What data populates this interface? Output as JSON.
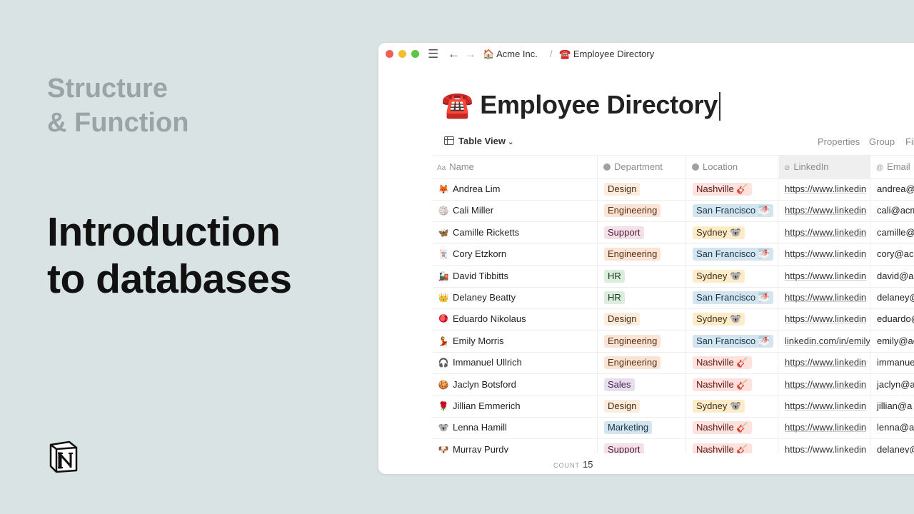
{
  "slide": {
    "subtitle": "Structure\n& Function",
    "title": "Introduction\nto databases"
  },
  "colors": {
    "background": "#d9e3e4",
    "subtitle": "#9aa3a6",
    "title": "#111111"
  },
  "window": {
    "breadcrumb": [
      {
        "icon": "🏠",
        "label": "Acme Inc."
      },
      {
        "icon": "☎️",
        "label": "Employee Directory"
      }
    ],
    "breadcrumb_separator": "/",
    "page_icon": "☎️",
    "page_title": "Employee Directory",
    "view_label": "Table View",
    "toolbar": {
      "properties": "Properties",
      "group": "Group",
      "filter": "Fil"
    },
    "columns": {
      "name": "Name",
      "department": "Department",
      "location": "Location",
      "linkedin": "LinkedIn",
      "email": "Email"
    },
    "rows": [
      {
        "icon": "🦊",
        "name": "Andrea Lim",
        "department": "Design",
        "location": "Nashville 🎸",
        "linkedin": "https://www.linkedin",
        "email": "andrea@"
      },
      {
        "icon": "🏐",
        "name": "Cali Miller",
        "department": "Engineering",
        "location": "San Francisco 🌁",
        "linkedin": "https://www.linkedin",
        "email": "cali@acm"
      },
      {
        "icon": "🦋",
        "name": "Camille Ricketts",
        "department": "Support",
        "location": "Sydney 🐨",
        "linkedin": "https://www.linkedin",
        "email": "camille@"
      },
      {
        "icon": "🃏",
        "name": "Cory Etzkorn",
        "department": "Engineering",
        "location": "San Francisco 🌁",
        "linkedin": "https://www.linkedin",
        "email": "cory@ac"
      },
      {
        "icon": "🚂",
        "name": "David Tibbitts",
        "department": "HR",
        "location": "Sydney 🐨",
        "linkedin": "https://www.linkedin",
        "email": "david@a"
      },
      {
        "icon": "👑",
        "name": "Delaney Beatty",
        "department": "HR",
        "location": "San Francisco 🌁",
        "linkedin": "https://www.linkedin",
        "email": "delaney@"
      },
      {
        "icon": "🪀",
        "name": "Eduardo Nikolaus",
        "department": "Design",
        "location": "Sydney 🐨",
        "linkedin": "https://www.linkedin",
        "email": "eduardo@"
      },
      {
        "icon": "💃",
        "name": "Emily Morris",
        "department": "Engineering",
        "location": "San Francisco 🌁",
        "linkedin": "linkedin.com/in/emily",
        "email": "emily@ac"
      },
      {
        "icon": "🎧",
        "name": "Immanuel Ullrich",
        "department": "Engineering",
        "location": "Nashville 🎸",
        "linkedin": "https://www.linkedin",
        "email": "immanue"
      },
      {
        "icon": "🍪",
        "name": "Jaclyn Botsford",
        "department": "Sales",
        "location": "Nashville 🎸",
        "linkedin": "https://www.linkedin",
        "email": "jaclyn@a"
      },
      {
        "icon": "🌹",
        "name": "Jillian Emmerich",
        "department": "Design",
        "location": "Sydney 🐨",
        "linkedin": "https://www.linkedin",
        "email": "jillian@a"
      },
      {
        "icon": "🐨",
        "name": "Lenna Hamill",
        "department": "Marketing",
        "location": "Nashville 🎸",
        "linkedin": "https://www.linkedin",
        "email": "lenna@a"
      },
      {
        "icon": "🐶",
        "name": "Murray Purdy",
        "department": "Support",
        "location": "Nashville 🎸",
        "linkedin": "https://www.linkedin",
        "email": "delaney@"
      }
    ],
    "count_label": "COUNT",
    "count_value": "15"
  }
}
